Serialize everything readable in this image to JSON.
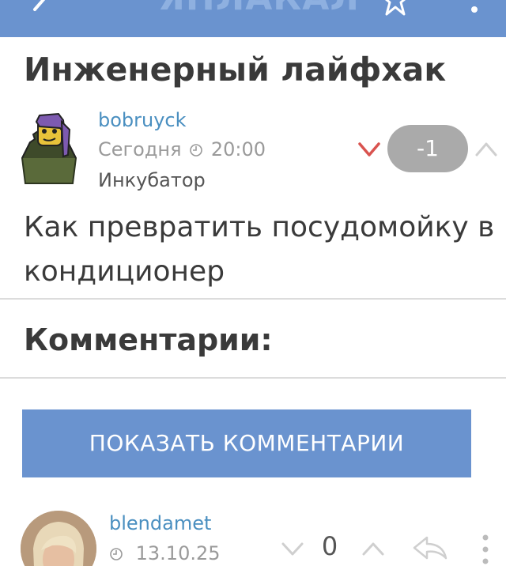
{
  "header": {
    "logo_text": "ЯПЛАКАЛ",
    "back_icon": "back-chevron-icon",
    "star_icon": "star-icon",
    "more_icon": "more-vertical-icon",
    "bg_color": "#6a93cf"
  },
  "post": {
    "title": "Инженерный лайфхак",
    "author": "bobruyck",
    "date_label": "Сегодня",
    "time": "20:00",
    "section": "Инкубатор",
    "score": "-1",
    "body": "Как превратить посудомойку в кондиционер"
  },
  "comments": {
    "heading": "Комментарии:",
    "show_button": "ПОКАЗАТЬ КОММЕНТАРИИ",
    "items": [
      {
        "author": "blendamet",
        "date": "13.10.25",
        "score": "0"
      }
    ]
  },
  "colors": {
    "accent": "#6a93cf",
    "link": "#4a8fc0",
    "downvote": "#d9534f",
    "badge": "#aaaaaa"
  }
}
